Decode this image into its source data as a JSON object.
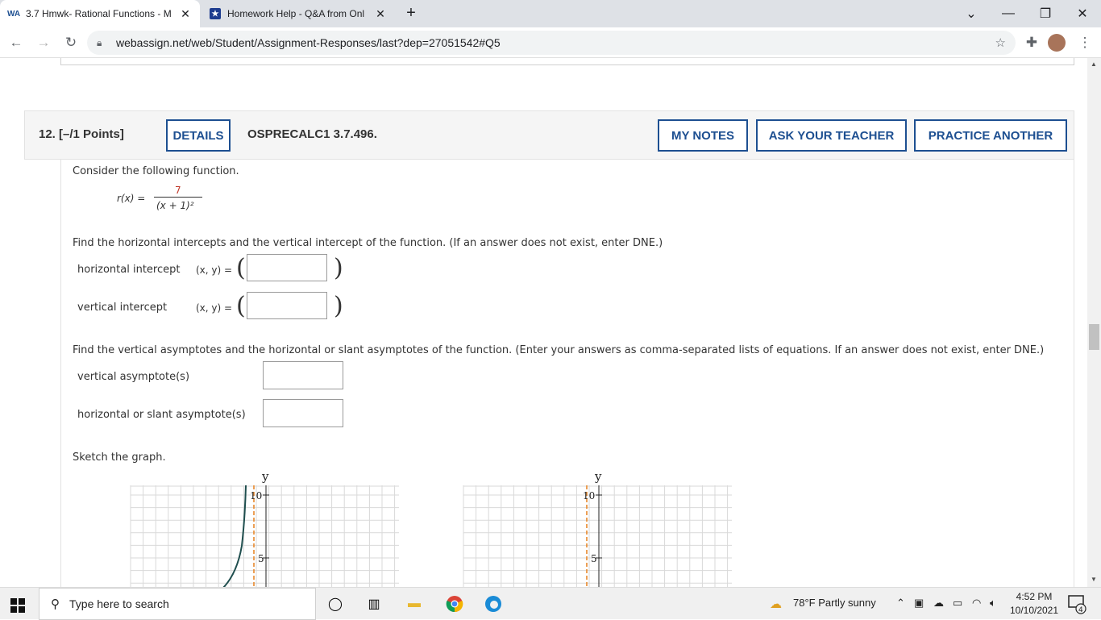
{
  "browser": {
    "tabs": [
      {
        "title": "3.7 Hmwk- Rational Functions - M",
        "favicon": "WA"
      },
      {
        "title": "Homework Help - Q&A from Onl",
        "favicon": "★"
      }
    ],
    "url": "webassign.net/web/Student/Assignment-Responses/last?dep=27051542#Q5"
  },
  "question": {
    "number": "12.",
    "points": "[–/1 Points]",
    "details_label": "DETAILS",
    "code": "OSPRECALC1 3.7.496.",
    "my_notes_label": "MY NOTES",
    "ask_teacher_label": "ASK YOUR TEACHER",
    "practice_label": "PRACTICE ANOTHER",
    "intro": "Consider the following function.",
    "function_lhs": "r(x)  =",
    "numerator": "7",
    "denominator": "(x + 1)²",
    "prompt1": "Find the horizontal intercepts and the vertical intercept of the function. (If an answer does not exist, enter DNE.)",
    "horizontal_intercept_label": "horizontal intercept",
    "vertical_intercept_label": "vertical intercept",
    "xy_label": "(x, y) =",
    "prompt2": "Find the vertical asymptotes and the horizontal or slant asymptotes of the function. (Enter your answers as comma-separated lists of equations. If an answer does not exist, enter DNE.)",
    "vertical_asymptote_label": "vertical asymptote(s)",
    "horizontal_slant_label": "horizontal or slant asymptote(s)",
    "sketch_label": "Sketch the graph."
  },
  "graphs": [
    {
      "y_axis_label": "y",
      "tick_10": "10",
      "tick_5": "5"
    },
    {
      "y_axis_label": "y",
      "tick_10": "10",
      "tick_5": "5"
    }
  ],
  "colors": {
    "accent": "#1d4f91",
    "asymptote": "#e8892c",
    "curve": "#1f4e4e",
    "numerator": "#c0392b"
  },
  "taskbar": {
    "search_placeholder": "Type here to search",
    "weather": "78°F  Partly sunny",
    "time": "4:52 PM",
    "date": "10/10/2021",
    "notification_count": "4"
  }
}
